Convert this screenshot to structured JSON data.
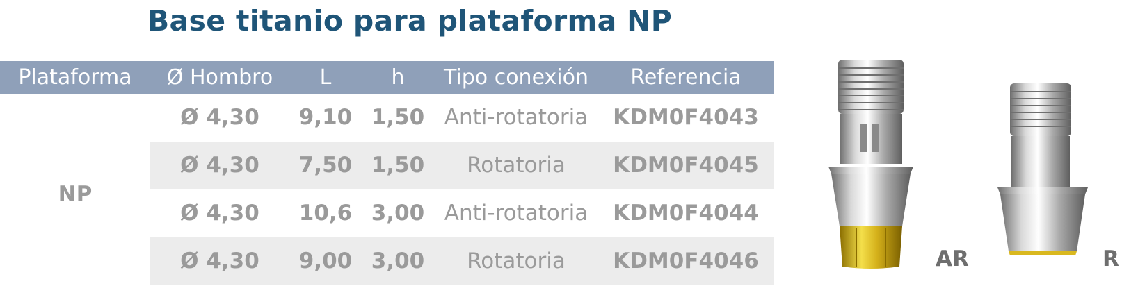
{
  "title": "Base titanio para plataforma NP",
  "table": {
    "headers": [
      "Plataforma",
      "Ø Hombro",
      "L",
      "h",
      "Tipo conexión",
      "Referencia"
    ],
    "platform": "NP",
    "rows": [
      {
        "hombro": "Ø 4,30",
        "L": "9,10",
        "h": "1,50",
        "conexion": "Anti-rotatoria",
        "referencia": "KDM0F4043"
      },
      {
        "hombro": "Ø 4,30",
        "L": "7,50",
        "h": "1,50",
        "conexion": "Rotatoria",
        "referencia": "KDM0F4045"
      },
      {
        "hombro": "Ø 4,30",
        "L": "10,6",
        "h": "3,00",
        "conexion": "Anti-rotatoria",
        "referencia": "KDM0F4044"
      },
      {
        "hombro": "Ø 4,30",
        "L": "9,00",
        "h": "3,00",
        "conexion": "Rotatoria",
        "referencia": "KDM0F4046"
      }
    ]
  },
  "products": [
    {
      "label": "AR"
    },
    {
      "label": "R"
    }
  ],
  "colors": {
    "title": "#1f5578",
    "header_bg": "#8fa0b9",
    "row_shade": "#ececec",
    "cell_text": "#9a9a9a",
    "gold": "#d9b81f"
  }
}
